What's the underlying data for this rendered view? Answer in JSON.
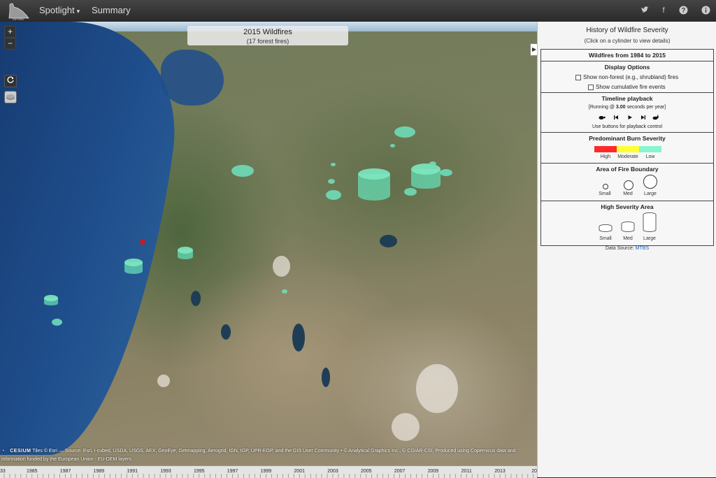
{
  "nav": {
    "spotlight": "Spotlight",
    "summary": "Summary",
    "logo_text": "INFORM",
    "icons": [
      "twitter-icon",
      "facebook-icon",
      "help-icon",
      "info-icon"
    ]
  },
  "map": {
    "title": "2015 Wildfires",
    "subtitle": "(17 forest fires)",
    "zoom_in": "+",
    "zoom_out": "−",
    "cesium": "CESIUM",
    "credit": "Tiles © Esri — Source: Esri, i-cubed, USDA, USGS, AEX, GeoEye, Getmapping, Aerogrid, IGN, IGP, UPR-EGP, and the GIS User Community • © Analytical Graphics Inc., © CGIAR-CSI, Produced using Copernicus data and information funded by the European Union - EU-DEM layers",
    "fire_color": "#7ce8c0",
    "highlight_fire_color": "#d01818"
  },
  "timeline": {
    "labels": [
      "33",
      "1985",
      "1987",
      "1989",
      "1991",
      "1993",
      "1995",
      "1997",
      "1999",
      "2001",
      "2003",
      "2005",
      "2007",
      "2009",
      "2011",
      "2013",
      "20"
    ]
  },
  "panel": {
    "title": "History of Wildfire Severity",
    "subtitle": "(Click on a cylinder to view details)",
    "range": "Wildfires from 1984 to 2015",
    "display_options": {
      "heading": "Display Options",
      "option1": "Show non-forest (e.g., shrubland) fires",
      "option2": "Show cumulative fire events"
    },
    "playback": {
      "heading": "Timeline playback",
      "status_prefix": "[Running @ ",
      "status_value": "3.00",
      "status_suffix": " seconds per year]",
      "hint": "Use buttons for playback control"
    },
    "burn": {
      "heading": "Predominant Burn Severity",
      "high": "High",
      "moderate": "Moderate",
      "low": "Low",
      "colors": {
        "high": "#ff2a2a",
        "moderate": "#ffff33",
        "low": "#88f5d0"
      }
    },
    "area": {
      "heading": "Area of Fire Boundary",
      "small": "Small",
      "med": "Med",
      "large": "Large"
    },
    "high_area": {
      "heading": "High Severity Area",
      "small": "Small",
      "med": "Med",
      "large": "Large"
    },
    "data_source_label": "Data Source: ",
    "data_source_link": "MTBS"
  }
}
